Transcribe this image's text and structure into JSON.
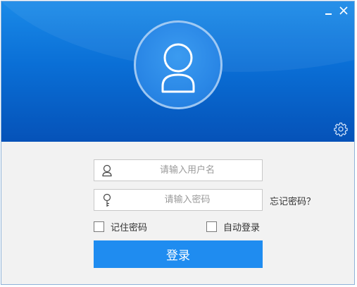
{
  "window": {
    "minimize_icon": "minimize-icon",
    "close_icon": "close-icon",
    "settings_icon": "gear-icon"
  },
  "avatar": {
    "icon": "user-avatar-icon"
  },
  "form": {
    "username_placeholder": "请输入用户名",
    "username_value": "",
    "password_placeholder": "请输入密码",
    "password_value": "",
    "forgot_password": "忘记密码？",
    "remember_password": "记住密码",
    "remember_checked": false,
    "auto_login": "自动登录",
    "auto_login_checked": false,
    "login_button": "登录"
  },
  "colors": {
    "header_blue": "#0a6fd6",
    "button_blue": "#1f8cf0",
    "background": "#f2f2f2"
  }
}
